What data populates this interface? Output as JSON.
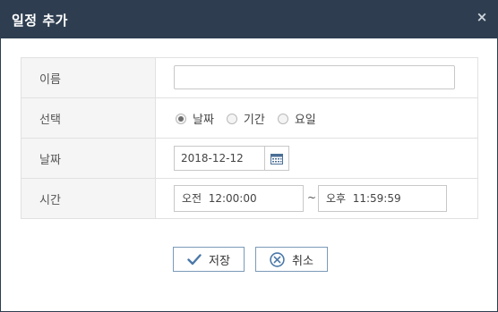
{
  "dialog": {
    "title": "일정 추가",
    "close_symbol": "×"
  },
  "form": {
    "name_label": "이름",
    "name_value": "",
    "select_label": "선택",
    "options": [
      {
        "label": "날짜",
        "checked": true
      },
      {
        "label": "기간",
        "checked": false
      },
      {
        "label": "요일",
        "checked": false
      }
    ],
    "date_label": "날짜",
    "date_value": "2018-12-12",
    "time_label": "시간",
    "time_start": "오전  12:00:00",
    "time_separator": "~",
    "time_end": "오후  11:59:59"
  },
  "buttons": {
    "save_label": "저장",
    "cancel_label": "취소"
  },
  "colors": {
    "titlebar": "#2e3e50",
    "button_border": "#7a9ab8",
    "icon_blue": "#4a78a8"
  }
}
